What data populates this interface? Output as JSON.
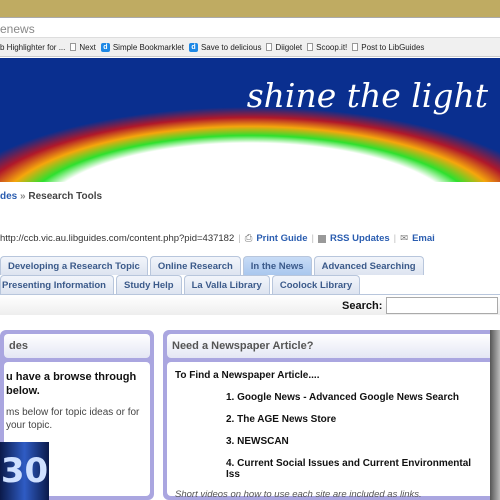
{
  "browser": {
    "address": "enews",
    "bookmarks": [
      {
        "label": "b Highlighter for ...",
        "icon": "none"
      },
      {
        "label": "Next",
        "icon": "page-icon"
      },
      {
        "label": "Simple Bookmarklet",
        "icon": "delicious-icon"
      },
      {
        "label": "Save to delicious",
        "icon": "delicious-icon"
      },
      {
        "label": "Diigolet",
        "icon": "page-icon"
      },
      {
        "label": "Scoop.it!",
        "icon": "page-icon"
      },
      {
        "label": "Post to LibGuides",
        "icon": "page-icon"
      }
    ]
  },
  "banner": {
    "slogan": "shine the light"
  },
  "breadcrumb": {
    "parent": "des",
    "sep": "»",
    "current": "Research Tools"
  },
  "toolbar": {
    "url": "http://ccb.vic.au.libguides.com/content.php?pid=437182",
    "print": "Print Guide",
    "rss": "RSS Updates",
    "email": "Emai"
  },
  "tabs_row1": [
    "Developing a Research Topic",
    "Online Research",
    "In the News",
    "Advanced Searching"
  ],
  "tabs_row2": [
    "Presenting Information",
    "Study Help",
    "La Valla Library",
    "Coolock Library"
  ],
  "active_tab": "In the News",
  "search": {
    "label": "Search:",
    "value": ""
  },
  "left_panel": {
    "title": "des",
    "bold": "u have a browse through below.",
    "bold_l1": "u have a browse through",
    "bold_l2": "below.",
    "text_l1": "ms below for topic ideas or for",
    "text_l2": "your topic.",
    "thumb_text": "30"
  },
  "right_panel": {
    "title": "Need a Newspaper Article?",
    "intro": "To Find a Newspaper Article....",
    "items": [
      "1. Google News - Advanced Google News Search",
      "2. The AGE News Store",
      "3. NEWSCAN",
      "4. Current Social Issues and Current Environmental Iss"
    ],
    "note": "Short videos on how to use each site are included as links."
  },
  "colors": {
    "banner_blue": "#0a2f8f",
    "panel_border": "#aaa6e0",
    "link": "#2a5db0",
    "chrome_gold": "#bfab62"
  }
}
